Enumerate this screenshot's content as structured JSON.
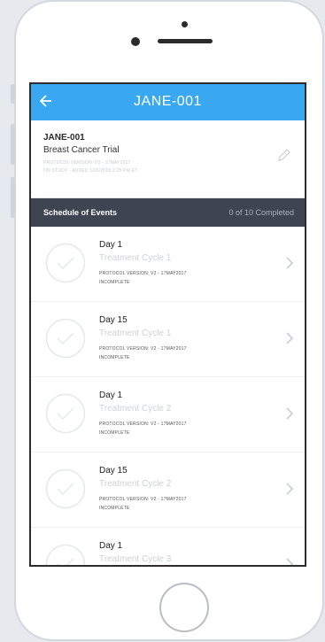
{
  "nav": {
    "title": "JANE-001",
    "back_icon": "arrow-left-icon",
    "bg_color": "#3aa8f0"
  },
  "patient": {
    "id": "JANE-001",
    "trial": "Breast Cancer Trial",
    "protocol_line": "PROTOCOL VERSION: V2 - 17MAY2017",
    "study_line": "ON STUDY - ADDED 12/6/2018 2:28 PM ET",
    "edit_icon": "pencil-icon"
  },
  "schedule": {
    "title": "Schedule of Events",
    "count": "0 of 10 Completed",
    "bg_color": "#3e4452"
  },
  "events": [
    {
      "day": "Day 1",
      "cycle": "Treatment Cycle 1",
      "protocol": "PROTOCOL VERSION: V2 - 17MAY2017",
      "status": "INCOMPLETE"
    },
    {
      "day": "Day 15",
      "cycle": "Treatment Cycle 1",
      "protocol": "PROTOCOL VERSION: V2 - 17MAY2017",
      "status": "INCOMPLETE"
    },
    {
      "day": "Day 1",
      "cycle": "Treatment Cycle 2",
      "protocol": "PROTOCOL VERSION: V2 - 17MAY2017",
      "status": "INCOMPLETE"
    },
    {
      "day": "Day 15",
      "cycle": "Treatment Cycle 2",
      "protocol": "PROTOCOL VERSION: V2 - 17MAY2017",
      "status": "INCOMPLETE"
    },
    {
      "day": "Day 1",
      "cycle": "Treatment Cycle 3",
      "protocol": "",
      "status": ""
    }
  ]
}
